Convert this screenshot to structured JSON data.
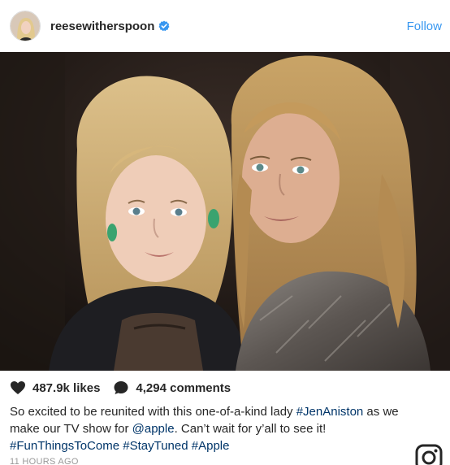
{
  "header": {
    "username": "reesewitherspoon",
    "verified": true,
    "follow_label": "Follow"
  },
  "stats": {
    "likes": "487.9k likes",
    "comments": "4,294 comments"
  },
  "caption": {
    "part1": "So excited to be reunited with this one-of-a-kind lady ",
    "tag_jen": "#JenAniston",
    "part2": " as we make our TV show for ",
    "mention_apple": "@apple",
    "part3": ". Can’t wait for y’all to see it! ",
    "tag_fun": "#FunThingsToCome",
    "tag_stay": "#StayTuned",
    "tag_apple": "#Apple"
  },
  "timestamp": "11 HOURS AGO",
  "colors": {
    "link": "#003569",
    "follow": "#3897f0",
    "verified": "#3897f0",
    "text": "#262626"
  },
  "icons": {
    "heart": "heart-icon",
    "comment": "comment-icon",
    "instagram": "instagram-logo-icon"
  }
}
